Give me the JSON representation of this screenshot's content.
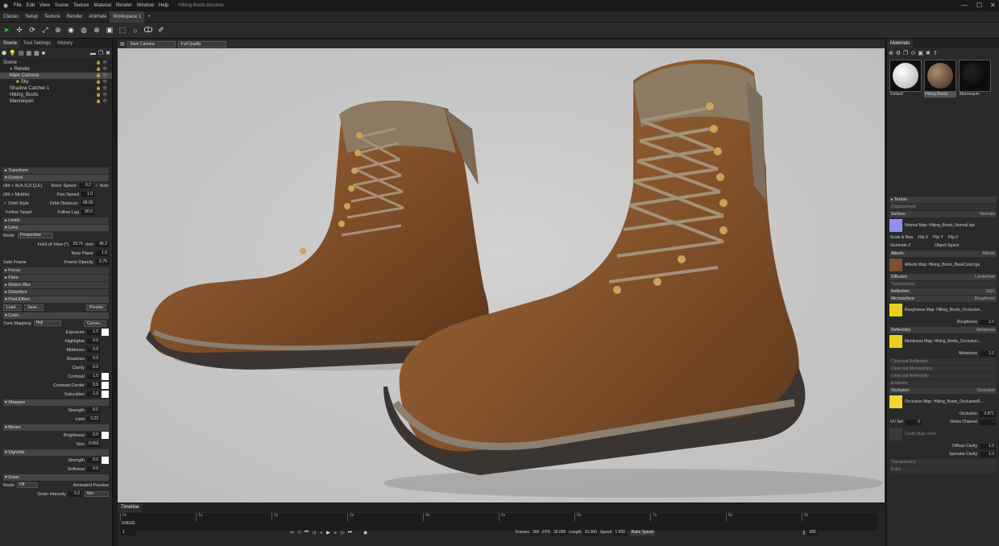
{
  "app": {
    "menu": [
      "File",
      "Edit",
      "View",
      "Scene",
      "Texture",
      "Material",
      "Render",
      "Window",
      "Help"
    ],
    "document": "Hiking Boots.tbscene",
    "workspaces": [
      "Classic",
      "Setup",
      "Texture",
      "Render",
      "Animate",
      "Workspace 1",
      "+"
    ],
    "active_workspace_index": 5
  },
  "left_panel": {
    "tabs": [
      "Scene",
      "Tool Settings",
      "History"
    ],
    "tree": [
      {
        "label": "Scene",
        "indent": 0,
        "selected": false
      },
      {
        "label": "Render",
        "indent": 1,
        "selected": false
      },
      {
        "label": "Main Camera",
        "indent": 1,
        "selected": true
      },
      {
        "label": "Sky",
        "indent": 2,
        "selected": false
      },
      {
        "label": "Shadow Catcher 1",
        "indent": 1,
        "selected": false
      },
      {
        "label": "Hiking_Boots",
        "indent": 1,
        "selected": false
      },
      {
        "label": "Mannequin",
        "indent": 1,
        "selected": false
      }
    ],
    "sections": {
      "transform": "Transform",
      "control": "Control",
      "control_props": [
        {
          "label": "(Alt + W,A,S,D,Q,E)",
          "label2": "Move Speed:",
          "value": "0.2",
          "extra": "Auto"
        },
        {
          "label": "(Alt + Middle)",
          "label2": "Pan Speed",
          "value": "1.0",
          "extra": ""
        },
        {
          "label": "Orbit Style",
          "label2": "Orbit Distance:",
          "value": "68.93",
          "extra": ""
        },
        {
          "label": "Follow Target",
          "label2": "Follow Lag",
          "value": "50.0",
          "extra": ""
        }
      ],
      "limits": "Limits",
      "lens": "Lens",
      "lens_mode_label": "Mode",
      "lens_mode": "Perspective",
      "fov_label": "Field of View (°)",
      "fov_value": "29.74",
      "mm_label": "mm:",
      "mm_value": "45.2",
      "near_plane_label": "Near Plane",
      "near_plane_value": "1.0",
      "safe_frame_label": "Safe Frame",
      "frame_opacity_label": "Frame Opacity",
      "frame_opacity_value": "0.75",
      "focus": "Focus",
      "flare": "Flare",
      "motion_blur": "Motion Blur",
      "distortion": "Distortion",
      "post_effect": "Post Effect",
      "load_label": "Load...",
      "save_label": "Save...",
      "presets_label": "Presets",
      "color": "Color",
      "tone_mapping_label": "Tone Mapping",
      "tone_mapping_value": "Hejl",
      "curves_label": "Curves...",
      "color_props": [
        {
          "label": "Exposure",
          "value": "1.0",
          "swatch": true
        },
        {
          "label": "Highlights",
          "value": "0.0",
          "swatch": false
        },
        {
          "label": "Midtones",
          "value": "0.0",
          "swatch": false
        },
        {
          "label": "Shadows",
          "value": "0.0",
          "swatch": false
        },
        {
          "label": "Clarity",
          "value": "0.0",
          "swatch": false
        },
        {
          "label": "Contrast",
          "value": "1.0",
          "swatch": true
        },
        {
          "label": "Contrast Center",
          "value": "0.5",
          "swatch": true
        },
        {
          "label": "Saturation",
          "value": "1.0",
          "swatch": true
        }
      ],
      "sharpen": "Sharpen",
      "sharpen_props": [
        {
          "label": "Strength",
          "value": "0.0"
        },
        {
          "label": "Limit",
          "value": "0.23"
        }
      ],
      "bloom": "Bloom",
      "bloom_props": [
        {
          "label": "Brightness",
          "value": "0.0",
          "swatch": true
        },
        {
          "label": "Size",
          "value": "0.063",
          "swatch": false
        }
      ],
      "vignette": "Vignette",
      "vignette_props": [
        {
          "label": "Strength",
          "value": "0.0",
          "swatch": true
        },
        {
          "label": "Softness",
          "value": "0.0",
          "swatch": false
        }
      ],
      "grain": "Grain",
      "grain_mode_label": "Mode",
      "grain_mode_value": "Off",
      "animated_preview_label": "Animated Preview",
      "grain_intensity_label": "Grain Intensity",
      "grain_intensity_value": "0.2",
      "grain_type_value": "fine"
    }
  },
  "viewport": {
    "camera_select": "Main Camera",
    "quality_select": "Full Quality"
  },
  "timeline": {
    "tab": "Timeline",
    "ticks": [
      "0s",
      "1s",
      "2s",
      "3s",
      "4s",
      "5s",
      "6s",
      "7s",
      "8s",
      "9s"
    ],
    "current_time": "0:00.01",
    "frame_field": "1",
    "frames_label": "Frames",
    "frames_value": "300",
    "fps_label": "FPS",
    "fps_value": "30.000",
    "length_label": "Length",
    "length_value": "10.000",
    "speed_label": "Speed",
    "speed_value": "1.000",
    "bake_speed_label": "Bake Speed",
    "end_field": "300"
  },
  "right_panel": {
    "tab": "Materials",
    "materials": [
      {
        "name": "Default",
        "kind": "white",
        "selected": false
      },
      {
        "name": "Hiking Boots",
        "kind": "leather",
        "selected": true
      },
      {
        "name": "Mannequin",
        "kind": "black",
        "selected": false
      }
    ],
    "texture_label": "Texture",
    "displacement_label": "Displacement:",
    "surface": {
      "label": "Surface:",
      "value": "Normals"
    },
    "normal_map": "Normal Map: Hiking_Boots_Normal.tga",
    "scale_bias": "Scale & Bias",
    "flip_x": "Flip X",
    "flip_y": "Flip Y",
    "flip_z": "Flip Z",
    "generate_z": "Generate Z",
    "object_space": "Object Space",
    "albedo": {
      "label": "Albedo:",
      "value": "Albedo"
    },
    "albedo_map": "Albedo Map: Hiking_Boots_BaseColor.tga",
    "color_label": "Color",
    "diffusion": {
      "label": "Diffusion:",
      "value": "Lambertian"
    },
    "transmission": "Transmission:",
    "reflection": {
      "label": "Reflection:",
      "value": "GGX"
    },
    "microsurface": {
      "label": "Microsurface:",
      "value": "Roughness"
    },
    "roughness_map": "Roughness Map: Hiking_Boots_Occlusion...",
    "channel_label": "Channel",
    "roughness_channel": "G",
    "roughness_label": "Roughness",
    "roughness_value": "1.0",
    "invert_label": "Invert",
    "reflectivity": {
      "label": "Reflectivity:",
      "value": "Metalness"
    },
    "metalness_map": "Metalness Map: Hiking_Boots_Occlusion...",
    "metalness_channel": "B",
    "metalness_label": "Metalness",
    "metalness_value": "1.0",
    "clearcoat_reflection": "Clearcoat Reflection:",
    "clearcoat_microsurface": "Clearcoat Microsurface:",
    "clearcoat_reflectivity": "Clearcoat Reflectivity:",
    "emission": "Emission:",
    "occlusion": {
      "label": "Occlusion:",
      "value": "Occlusion"
    },
    "occlusion_map": "Occlusion Map: Hiking_Boots_OcclusionR...",
    "occlusion_channel": "R",
    "occlusion_label": "Occlusion",
    "occlusion_value": "0.871",
    "uv_set_label": "UV Set",
    "uv_set_value": "0",
    "vertex_channel_label": "Vertex Channel",
    "vertex_channel_value": "-",
    "cavity_map": "Cavity Map: none",
    "cavity_channel": "R",
    "diffuse_cavity_label": "Diffuse Cavity",
    "diffuse_cavity_value": "1.0",
    "specular_cavity_label": "Specular Cavity",
    "specular_cavity_value": "1.0",
    "transparency": "Transparency:",
    "extra": "Extra:"
  },
  "colors": {
    "accent_green": "#3cc83c",
    "viewport_bg": "#c8c8c8",
    "leather": "#8a5630"
  }
}
